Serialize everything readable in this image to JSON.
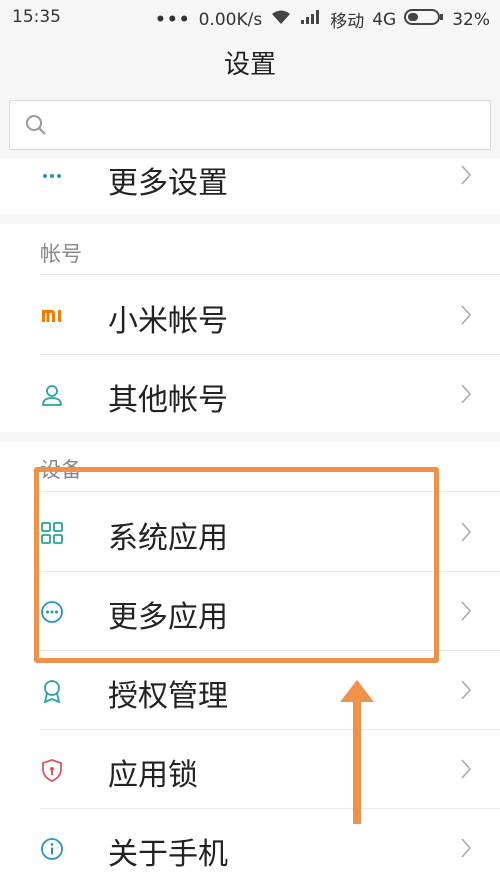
{
  "status_bar": {
    "time": "15:35",
    "dots": "•••",
    "speed": "0.00K/s",
    "carrier": "移动",
    "network": "4G",
    "battery": "32%"
  },
  "title": "设置",
  "search": {
    "placeholder": ""
  },
  "top_row": {
    "label": "更多设置",
    "icon": "more-dots-icon"
  },
  "accounts": {
    "header": "帐号",
    "items": [
      {
        "label": "小米帐号",
        "icon": "mi-logo-icon"
      },
      {
        "label": "其他帐号",
        "icon": "person-icon"
      }
    ]
  },
  "device": {
    "header": "设备",
    "items": [
      {
        "label": "系统应用",
        "icon": "grid-icon"
      },
      {
        "label": "更多应用",
        "icon": "more-circle-icon"
      },
      {
        "label": "授权管理",
        "icon": "ribbon-icon"
      },
      {
        "label": "应用锁",
        "icon": "shield-lock-icon"
      },
      {
        "label": "关于手机",
        "icon": "info-icon"
      }
    ]
  },
  "colors": {
    "accent_teal": "#26a69a",
    "mi_orange": "#f57c00",
    "annotation_orange": "#f0914a",
    "lock_red": "#e0555e",
    "info_blue": "#2196c9"
  }
}
